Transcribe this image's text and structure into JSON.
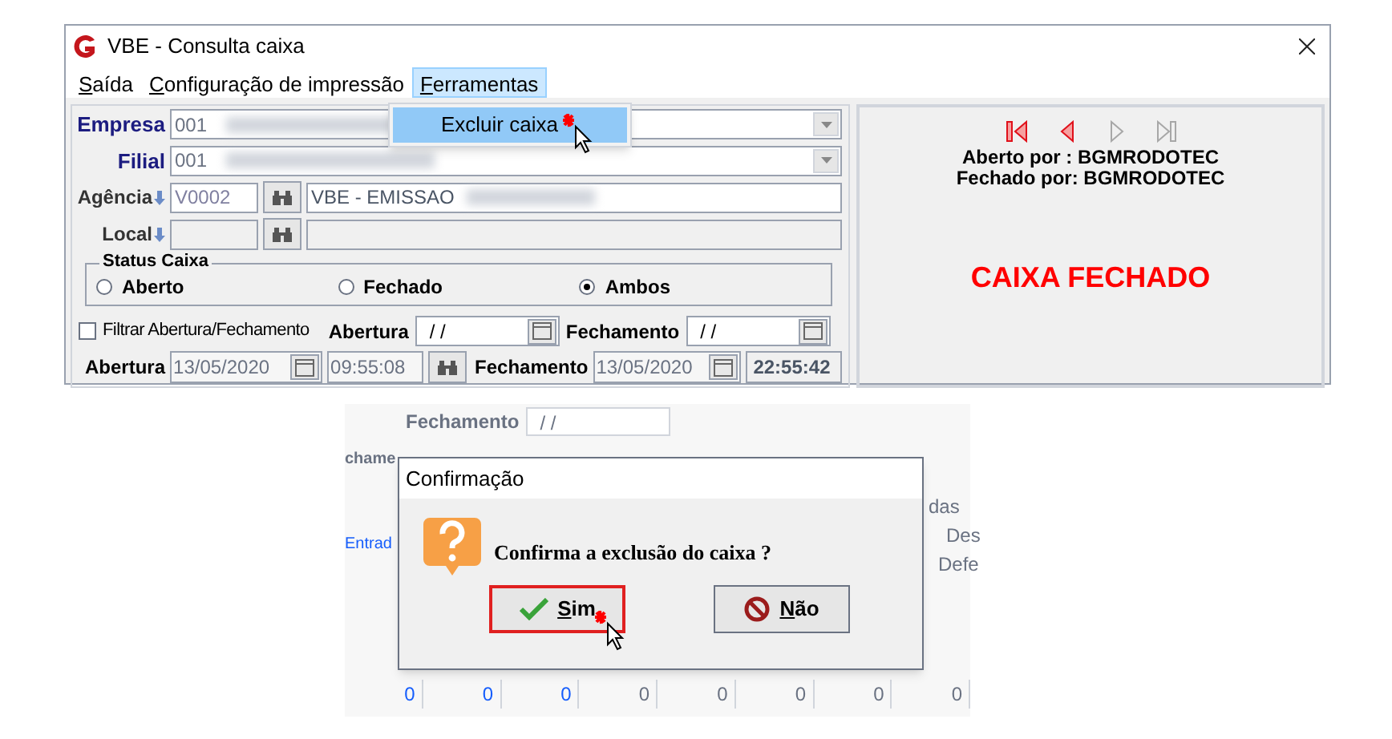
{
  "window": {
    "title": "VBE - Consulta caixa"
  },
  "menu": [
    {
      "label": "Saída",
      "open": false
    },
    {
      "label": "Configuração de impressão",
      "open": false
    },
    {
      "label": "Ferramentas",
      "open": true
    }
  ],
  "dropdown": {
    "items": [
      {
        "label": "Excluir caixa",
        "selected": true
      }
    ]
  },
  "form": {
    "empresa": {
      "label": "Empresa",
      "value": "001"
    },
    "filial": {
      "label": "Filial",
      "value": "001"
    },
    "agencia": {
      "label": "Agência",
      "code": "V0002",
      "name": "VBE - EMISSAO"
    },
    "local": {
      "label": "Local"
    },
    "status": {
      "title": "Status Caixa",
      "options": [
        {
          "label": "Aberto",
          "selected": false
        },
        {
          "label": "Fechado",
          "selected": false
        },
        {
          "label": "Ambos",
          "selected": true
        }
      ]
    },
    "filter": {
      "label": "Filtrar Abertura/Fechamento",
      "checked": false,
      "abertura_label": "Abertura",
      "abertura_value": "/ /",
      "fechamento_label": "Fechamento",
      "fechamento_value": "/ /"
    },
    "bottom": {
      "abertura_label": "Abertura",
      "abertura_date": "13/05/2020",
      "abertura_time": "09:55:08",
      "fechamento_label": "Fechamento",
      "fechamento_date": "13/05/2020",
      "fechamento_time": "22:55:42"
    }
  },
  "panel": {
    "nav": [
      {
        "kind": "first",
        "disabled": false
      },
      {
        "kind": "prev",
        "disabled": false
      },
      {
        "kind": "next",
        "disabled": true
      },
      {
        "kind": "last",
        "disabled": true
      }
    ],
    "opened_by": "Aberto por : BGMRODOTEC",
    "closed_by": "Fechado por: BGMRODOTEC",
    "status": "CAIXA FECHADO"
  },
  "background": {
    "fechamento_label": "Fechamento",
    "fechamento_value": "/ /",
    "cut_label": "chame",
    "header_text": "das",
    "link_text": "Entrad",
    "col_a": "Des",
    "col_b": "Defe",
    "zeros": [
      "0",
      "0",
      "0",
      "0",
      "0",
      "0",
      "0",
      "0"
    ]
  },
  "dialog": {
    "title": "Confirmação",
    "message": "Confirma a exclusão do caixa ?",
    "buttons": [
      {
        "kind": "yes",
        "label": "Sim",
        "focused": true
      },
      {
        "kind": "no",
        "label": "Não",
        "focused": false
      }
    ]
  }
}
